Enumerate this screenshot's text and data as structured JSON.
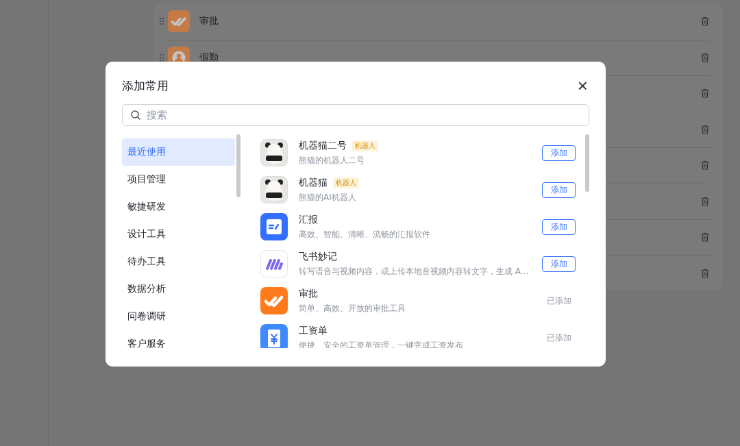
{
  "background_list": {
    "items": [
      {
        "name": "审批",
        "kind": "approval"
      },
      {
        "name": "假勤",
        "kind": "attendance"
      },
      {
        "kind": "covered"
      },
      {
        "kind": "covered"
      },
      {
        "kind": "covered"
      },
      {
        "kind": "covered"
      },
      {
        "kind": "covered"
      },
      {
        "kind": "covered"
      }
    ]
  },
  "dialog": {
    "title": "添加常用",
    "close": "×",
    "search": {
      "placeholder": "搜索"
    },
    "categories": [
      {
        "label": "最近使用",
        "selected": true
      },
      {
        "label": "项目管理",
        "selected": false
      },
      {
        "label": "敏捷研发",
        "selected": false
      },
      {
        "label": "设计工具",
        "selected": false
      },
      {
        "label": "待办工具",
        "selected": false
      },
      {
        "label": "数据分析",
        "selected": false
      },
      {
        "label": "问卷调研",
        "selected": false
      },
      {
        "label": "客户服务",
        "selected": false
      }
    ],
    "apps": [
      {
        "name": "机器猫二号",
        "tag": "机器人",
        "description": "熊猫的机器人二号",
        "kind": "picture",
        "added": false,
        "action": "添加"
      },
      {
        "name": "机器猫",
        "tag": "机器人",
        "description": "熊猫的AI机器人",
        "kind": "picture",
        "added": false,
        "action": "添加"
      },
      {
        "name": "汇报",
        "description": "高效、智能、清晰、流畅的汇报软件",
        "kind": "report",
        "added": false,
        "action": "添加"
      },
      {
        "name": "飞书妙记",
        "description": "转写语音与视频内容，或上传本地音视频内容转文字，生成 A...",
        "kind": "minutes",
        "added": false,
        "action": "添加"
      },
      {
        "name": "审批",
        "description": "简单、高效、开放的审批工具",
        "kind": "approval",
        "added": true,
        "action": "已添加"
      },
      {
        "name": "工资单",
        "description": "便捷、安全的工资单管理，一键完成工资发布",
        "kind": "payroll",
        "added": true,
        "action": "已添加"
      }
    ]
  }
}
